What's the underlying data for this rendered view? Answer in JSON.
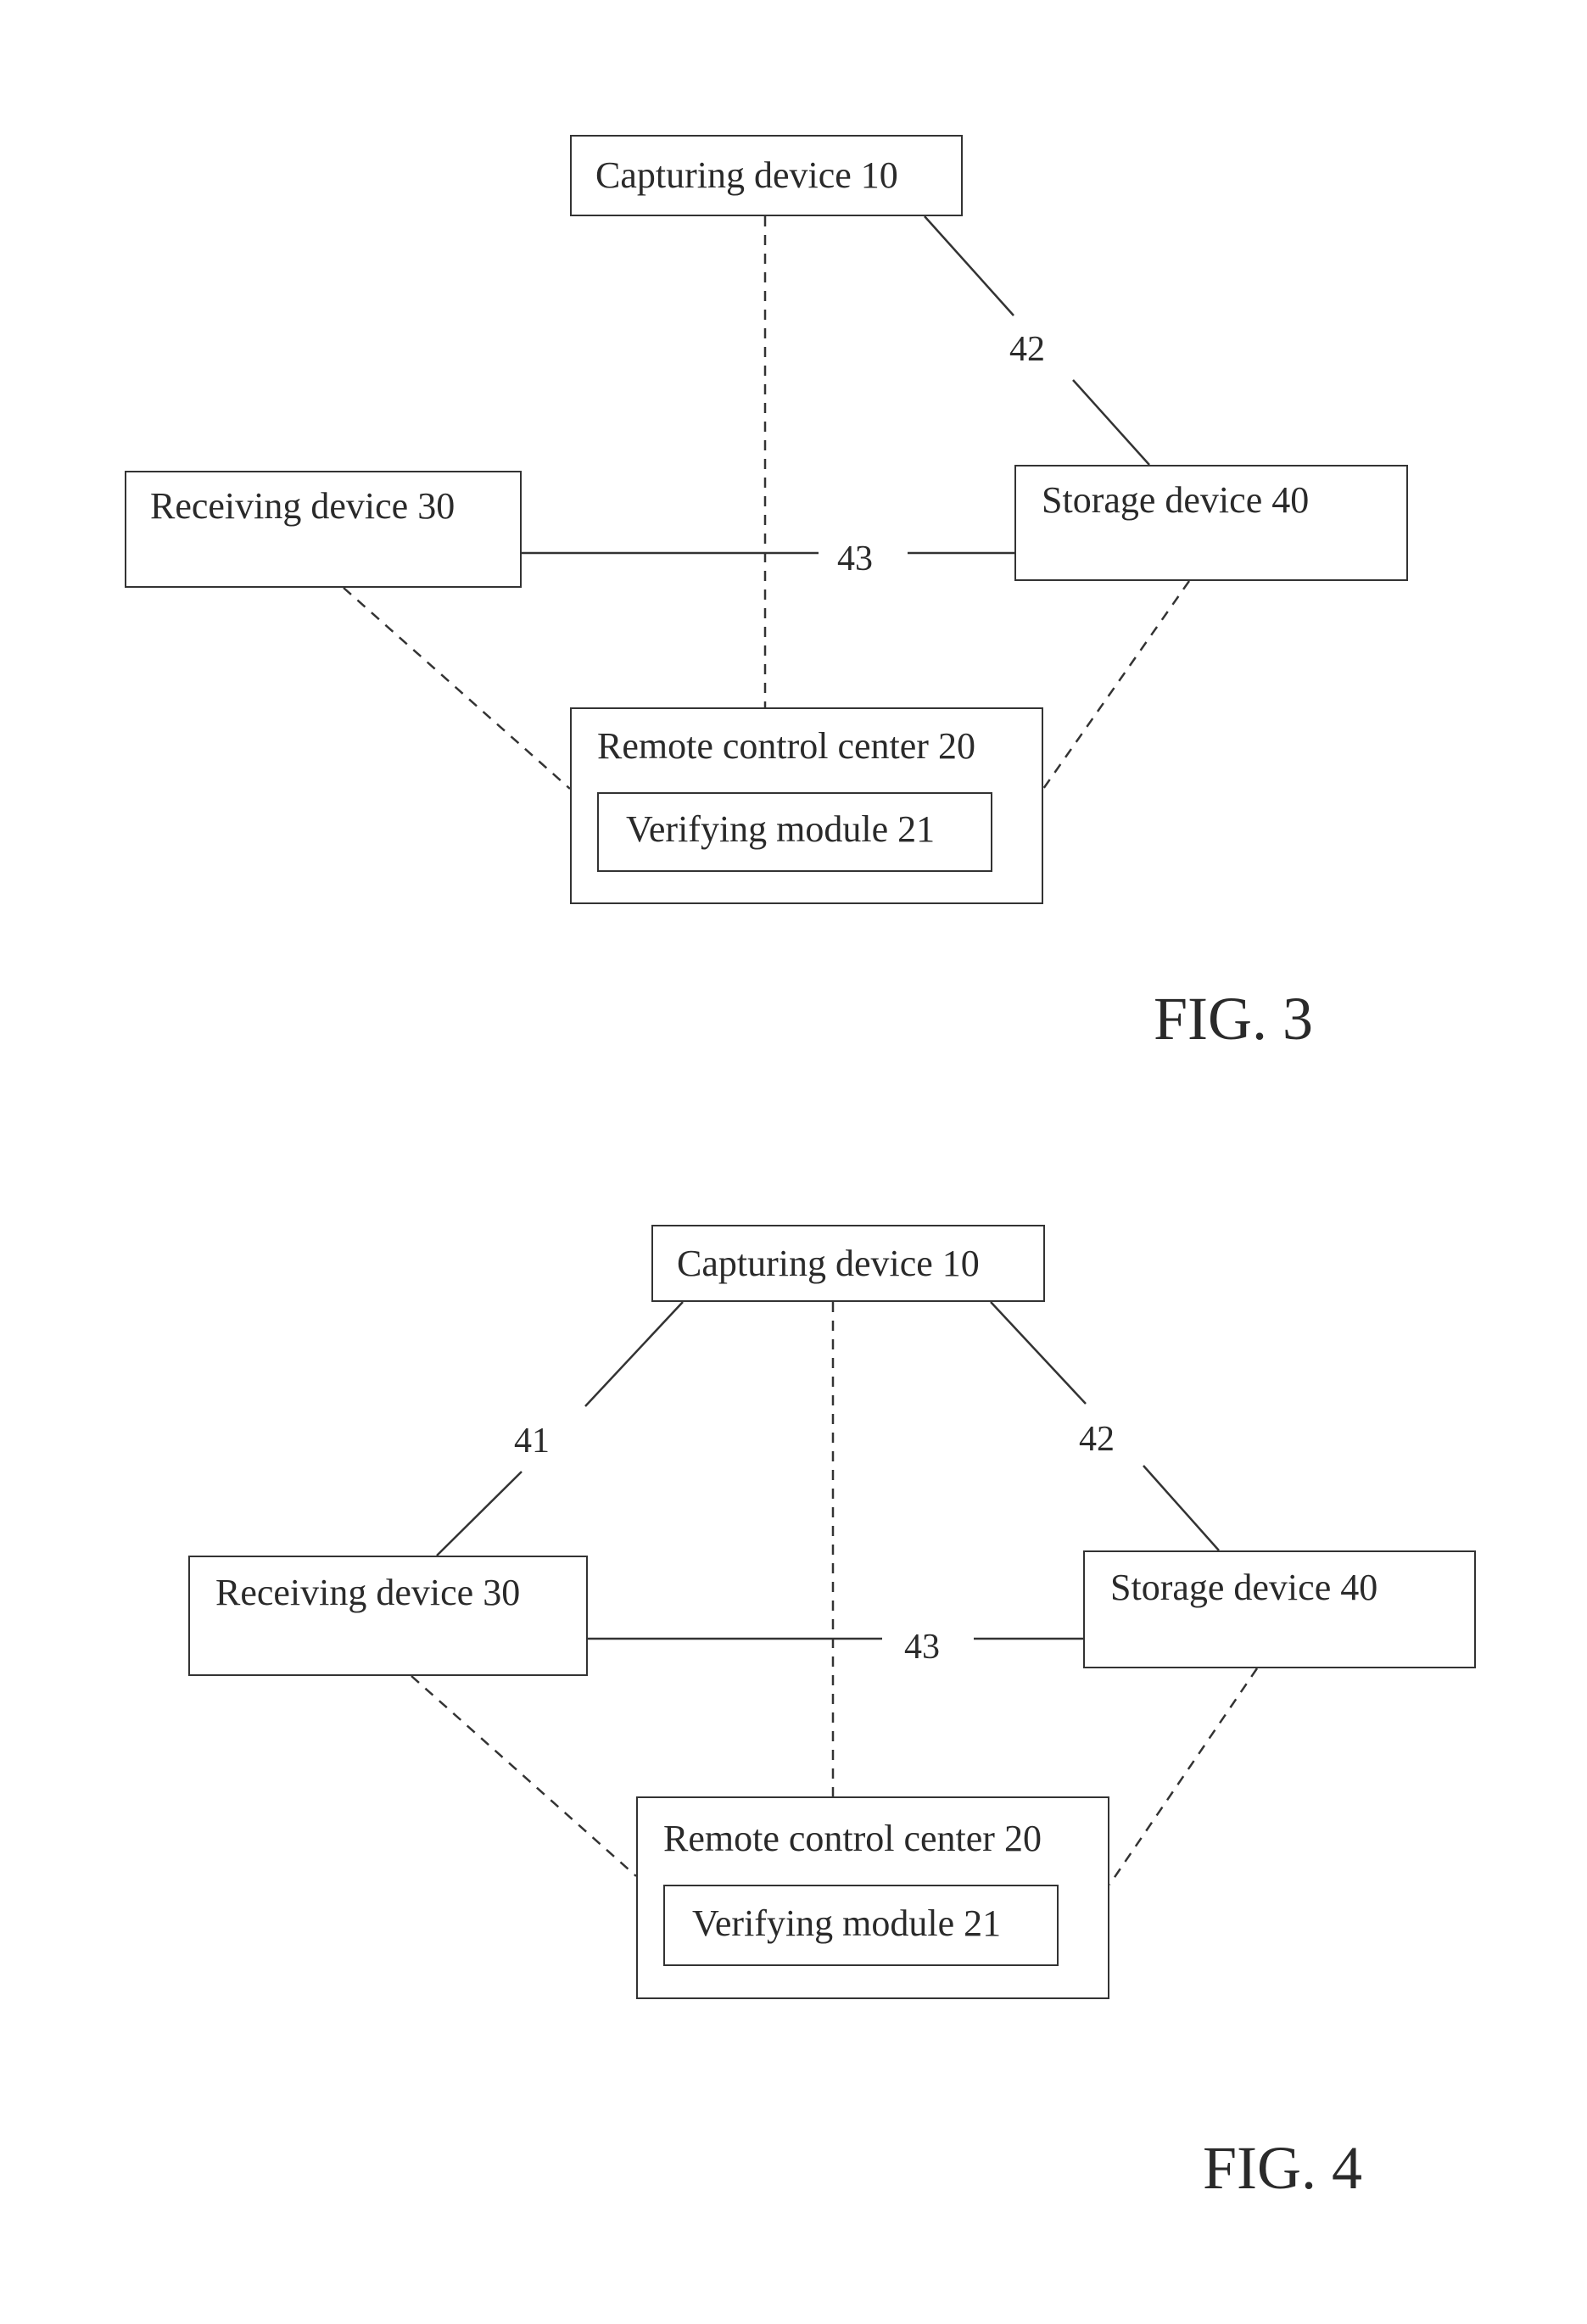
{
  "figures": [
    {
      "caption": "FIG. 3",
      "nodes": {
        "capturing": "Capturing device 10",
        "receiving": "Receiving device 30",
        "storage": "Storage device 40",
        "remote": "Remote control center 20",
        "verifying": "Verifying module 21"
      },
      "links": [
        {
          "from": "capturing",
          "to": "storage",
          "style": "solid",
          "label": "42"
        },
        {
          "from": "receiving",
          "to": "storage",
          "style": "solid",
          "label": "43"
        },
        {
          "from": "capturing",
          "to": "remote",
          "style": "dashed",
          "label": ""
        },
        {
          "from": "receiving",
          "to": "remote",
          "style": "dashed",
          "label": ""
        },
        {
          "from": "storage",
          "to": "remote",
          "style": "dashed",
          "label": ""
        }
      ]
    },
    {
      "caption": "FIG. 4",
      "nodes": {
        "capturing": "Capturing device 10",
        "receiving": "Receiving device 30",
        "storage": "Storage device 40",
        "remote": "Remote control center 20",
        "verifying": "Verifying module 21"
      },
      "links": [
        {
          "from": "capturing",
          "to": "receiving",
          "style": "solid",
          "label": "41"
        },
        {
          "from": "capturing",
          "to": "storage",
          "style": "solid",
          "label": "42"
        },
        {
          "from": "receiving",
          "to": "storage",
          "style": "solid",
          "label": "43"
        },
        {
          "from": "capturing",
          "to": "remote",
          "style": "dashed",
          "label": ""
        },
        {
          "from": "receiving",
          "to": "remote",
          "style": "dashed",
          "label": ""
        },
        {
          "from": "storage",
          "to": "remote",
          "style": "dashed",
          "label": ""
        }
      ]
    }
  ]
}
